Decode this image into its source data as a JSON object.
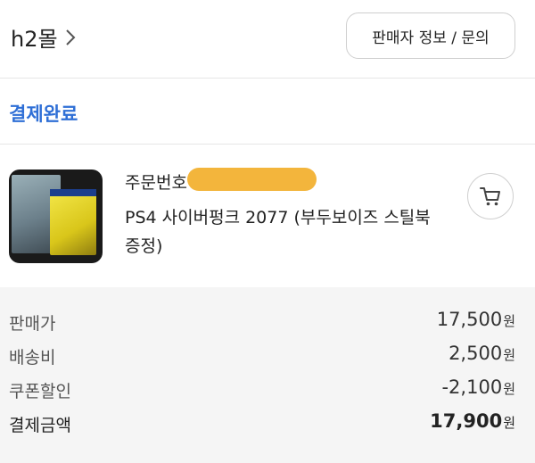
{
  "header": {
    "shop_name": "h2몰",
    "seller_button": "판매자 정보 / 문의"
  },
  "order": {
    "status": "결제완료",
    "order_number_label": "주문번호",
    "product_name": "PS4 사이버펑크 2077 (부두보이즈 스틸북 증정)"
  },
  "summary": {
    "currency": "원",
    "rows": [
      {
        "label": "판매가",
        "value": "17,500"
      },
      {
        "label": "배송비",
        "value": "2,500"
      },
      {
        "label": "쿠폰할인",
        "value": "-2,100"
      },
      {
        "label": "결제금액",
        "value": "17,900"
      }
    ]
  },
  "colors": {
    "accent": "#2f6fd6",
    "redaction": "#f3b53c",
    "summary_bg": "#f5f5f5"
  },
  "icons": {
    "shop_chevron": "chevron-right-icon",
    "cart": "cart-icon"
  }
}
